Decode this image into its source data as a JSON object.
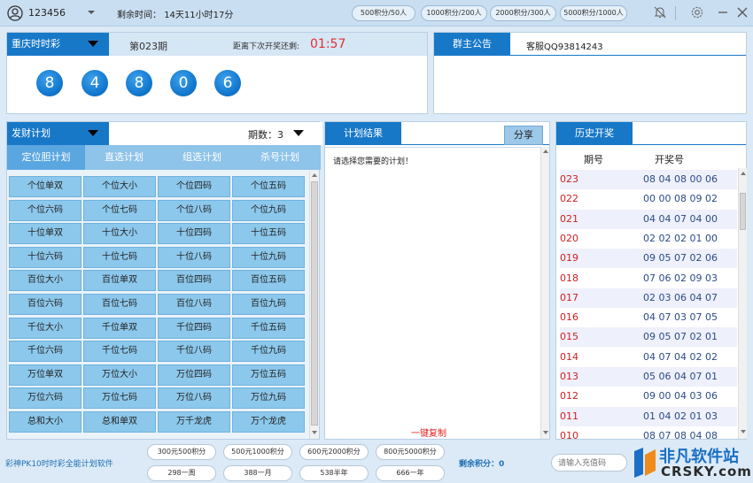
{
  "header": {
    "username": "123456",
    "remaining_label": "剩余时间：",
    "remaining_value": "14天11小时17分",
    "packages": [
      "500积分/50人",
      "1000积分/200人",
      "2000积分/300人",
      "5000积分/1000人"
    ]
  },
  "lottery": {
    "title": "重庆时时彩",
    "issue": "第023期",
    "next_label": "距离下次开奖还剩:",
    "countdown": "01:57",
    "balls": [
      "8",
      "4",
      "8",
      "0",
      "6"
    ]
  },
  "notice": {
    "tab": "群主公告",
    "text": "客服QQ93814243"
  },
  "plan": {
    "title": "发财计划",
    "period_label": "期数：3",
    "subtabs": [
      "定位胆计划",
      "直选计划",
      "组选计划",
      "杀号计划"
    ],
    "cells": [
      [
        "个位单双",
        "个位大小",
        "个位四码",
        "个位五码"
      ],
      [
        "个位六码",
        "个位七码",
        "个位八码",
        "个位九码"
      ],
      [
        "十位单双",
        "十位大小",
        "十位四码",
        "十位五码"
      ],
      [
        "十位六码",
        "十位七码",
        "十位八码",
        "十位九码"
      ],
      [
        "百位大小",
        "百位单双",
        "百位四码",
        "百位五码"
      ],
      [
        "百位六码",
        "百位七码",
        "百位八码",
        "百位九码"
      ],
      [
        "千位大小",
        "千位单双",
        "千位四码",
        "千位五码"
      ],
      [
        "千位六码",
        "千位七码",
        "千位八码",
        "千位九码"
      ],
      [
        "万位单双",
        "万位大小",
        "万位四码",
        "万位五码"
      ],
      [
        "万位六码",
        "万位七码",
        "万位八码",
        "万位九码"
      ],
      [
        "总和大小",
        "总和单双",
        "万千龙虎",
        "万个龙虎"
      ]
    ]
  },
  "result": {
    "tab": "计划结果",
    "share": "分享",
    "placeholder": "请选择您需要的计划！",
    "copy": "一键复制"
  },
  "history": {
    "tab": "历史开奖",
    "col_issue": "期号",
    "col_number": "开奖号",
    "rows": [
      [
        "023",
        "08 04 08 00 06"
      ],
      [
        "022",
        "00 00 08 09 02"
      ],
      [
        "021",
        "04 04 07 04 00"
      ],
      [
        "020",
        "02 02 02 01 00"
      ],
      [
        "019",
        "09 05 07 02 06"
      ],
      [
        "018",
        "07 06 02 09 03"
      ],
      [
        "017",
        "02 03 06 04 07"
      ],
      [
        "016",
        "04 07 03 07 05"
      ],
      [
        "015",
        "09 05 07 02 01"
      ],
      [
        "014",
        "04 07 04 02 02"
      ],
      [
        "013",
        "05 06 04 07 01"
      ],
      [
        "012",
        "09 00 04 03 06"
      ],
      [
        "011",
        "01 04 02 01 03"
      ],
      [
        "010",
        "08 07 08 04 08"
      ]
    ]
  },
  "footer": {
    "app_name": "彩神PK10时时彩全能计划软件",
    "buy_row1": [
      "300元500积分",
      "500元1000积分",
      "600元2000积分",
      "800元5000积分"
    ],
    "buy_row2": [
      "298一周",
      "388一月",
      "538半年",
      "666一年"
    ],
    "remain_points": "剩余积分：0",
    "recharge_placeholder": "请输入充值码"
  },
  "watermark": {
    "cn": "非凡软件站",
    "en": "CRSKY.com"
  },
  "colors": {
    "accent": "#1878c8",
    "ball": "#137ad0",
    "cell": "#8cc8ec",
    "red": "#e23030"
  }
}
